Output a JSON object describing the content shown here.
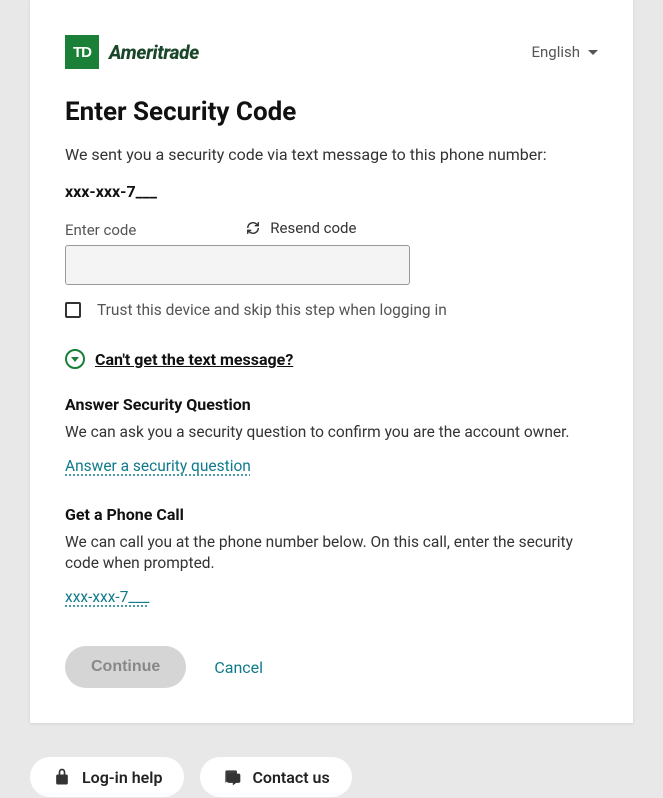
{
  "header": {
    "brand_name": "Ameritrade",
    "language": "English"
  },
  "main": {
    "title": "Enter Security Code",
    "instruction": "We sent you a security code via text message to this phone number:",
    "masked_phone": "xxx-xxx-7___",
    "enter_code_label": "Enter code",
    "resend_label": "Resend code",
    "code_value": "",
    "trust_label": "Trust this device and skip this step when logging in",
    "disclosure_label": "Can't get the text message?",
    "security_q": {
      "heading": "Answer Security Question",
      "body": "We can ask you a security question to confirm you are the account owner.",
      "link": "Answer a security question"
    },
    "phone_call": {
      "heading": "Get a Phone Call",
      "body": "We can call you at the phone number below. On this call, enter the security code when prompted.",
      "link": "xxx-xxx-7___"
    },
    "continue_label": "Continue",
    "cancel_label": "Cancel"
  },
  "footer": {
    "login_help": "Log-in help",
    "contact_us": "Contact us"
  }
}
